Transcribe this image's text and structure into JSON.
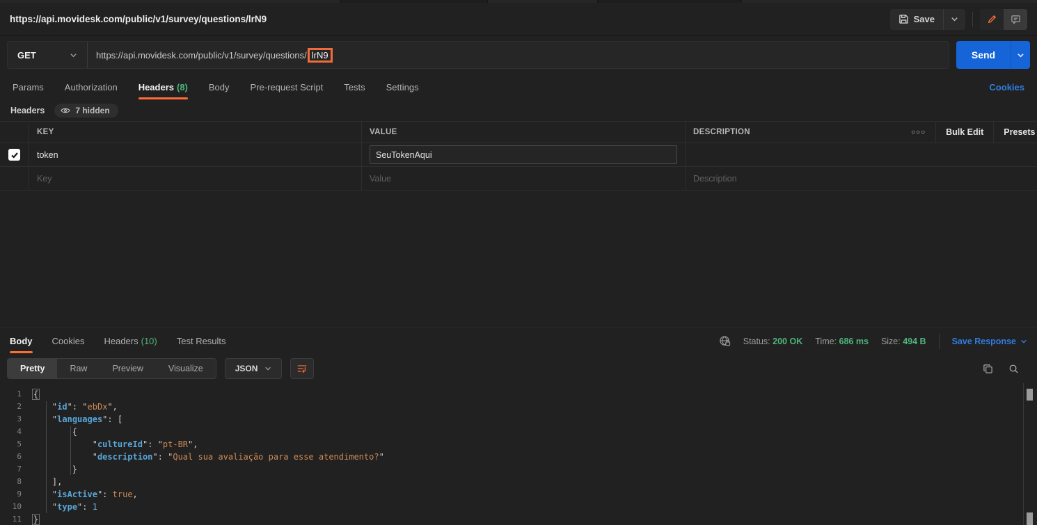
{
  "title_bar": {
    "title": "https://api.movidesk.com/public/v1/survey/questions/lrN9",
    "save_label": "Save"
  },
  "request": {
    "method": "GET",
    "url_prefix": "https://api.movidesk.com/public/v1/survey/questions/",
    "url_highlight": "lrN9",
    "send_label": "Send",
    "cookies_link": "Cookies",
    "tabs": [
      {
        "label": "Params"
      },
      {
        "label": "Authorization"
      },
      {
        "label": "Headers",
        "count": "(8)"
      },
      {
        "label": "Body"
      },
      {
        "label": "Pre-request Script"
      },
      {
        "label": "Tests"
      },
      {
        "label": "Settings"
      }
    ],
    "headers_section": {
      "title": "Headers",
      "hidden_badge": "7 hidden"
    },
    "table": {
      "columns": {
        "key": "KEY",
        "value": "VALUE",
        "description": "DESCRIPTION"
      },
      "bulk_edit": "Bulk Edit",
      "presets": "Presets",
      "row": {
        "key": "token",
        "value": "SeuTokenAqui",
        "description": ""
      },
      "placeholders": {
        "key": "Key",
        "value": "Value",
        "description": "Description"
      }
    }
  },
  "response": {
    "tabs": [
      {
        "label": "Body"
      },
      {
        "label": "Cookies"
      },
      {
        "label": "Headers",
        "count": "(10)"
      },
      {
        "label": "Test Results"
      }
    ],
    "meta": {
      "status_label": "Status:",
      "status_value": "200 OK",
      "time_label": "Time:",
      "time_value": "686 ms",
      "size_label": "Size:",
      "size_value": "494 B",
      "save_response": "Save Response"
    },
    "views": {
      "pretty": "Pretty",
      "raw": "Raw",
      "preview": "Preview",
      "visualize": "Visualize"
    },
    "format": "JSON",
    "code": {
      "lines": [
        {
          "n": "1",
          "t": [
            [
              "{",
              "pb"
            ]
          ]
        },
        {
          "n": "2",
          "t": [
            [
              "    ",
              ""
            ],
            [
              "\"",
              "q"
            ],
            [
              "id",
              "k"
            ],
            [
              "\"",
              "q"
            ],
            [
              ":",
              "p"
            ],
            [
              " ",
              ""
            ],
            [
              "\"",
              "q"
            ],
            [
              "ebDx",
              "s"
            ],
            [
              "\"",
              "q"
            ],
            [
              ",",
              "p"
            ]
          ]
        },
        {
          "n": "3",
          "t": [
            [
              "    ",
              ""
            ],
            [
              "\"",
              "q"
            ],
            [
              "languages",
              "k"
            ],
            [
              "\"",
              "q"
            ],
            [
              ":",
              "p"
            ],
            [
              " ",
              ""
            ],
            [
              "[",
              "p"
            ]
          ]
        },
        {
          "n": "4",
          "t": [
            [
              "        ",
              ""
            ],
            [
              "{",
              "p"
            ]
          ]
        },
        {
          "n": "5",
          "t": [
            [
              "            ",
              ""
            ],
            [
              "\"",
              "q"
            ],
            [
              "cultureId",
              "k"
            ],
            [
              "\"",
              "q"
            ],
            [
              ":",
              "p"
            ],
            [
              " ",
              ""
            ],
            [
              "\"",
              "q"
            ],
            [
              "pt-BR",
              "s"
            ],
            [
              "\"",
              "q"
            ],
            [
              ",",
              "p"
            ]
          ]
        },
        {
          "n": "6",
          "t": [
            [
              "            ",
              ""
            ],
            [
              "\"",
              "q"
            ],
            [
              "description",
              "k"
            ],
            [
              "\"",
              "q"
            ],
            [
              ":",
              "p"
            ],
            [
              " ",
              ""
            ],
            [
              "\"",
              "q"
            ],
            [
              "Qual sua avaliação para esse atendimento?",
              "s"
            ],
            [
              "\"",
              "q"
            ]
          ]
        },
        {
          "n": "7",
          "t": [
            [
              "        ",
              ""
            ],
            [
              "}",
              "p"
            ]
          ]
        },
        {
          "n": "8",
          "t": [
            [
              "    ",
              ""
            ],
            [
              "],",
              "p"
            ]
          ]
        },
        {
          "n": "9",
          "t": [
            [
              "    ",
              ""
            ],
            [
              "\"",
              "q"
            ],
            [
              "isActive",
              "k"
            ],
            [
              "\"",
              "q"
            ],
            [
              ":",
              "p"
            ],
            [
              " ",
              ""
            ],
            [
              "true",
              "b"
            ],
            [
              ",",
              "p"
            ]
          ]
        },
        {
          "n": "10",
          "t": [
            [
              "    ",
              ""
            ],
            [
              "\"",
              "q"
            ],
            [
              "type",
              "k"
            ],
            [
              "\"",
              "q"
            ],
            [
              ":",
              "p"
            ],
            [
              " ",
              ""
            ],
            [
              "1",
              "n"
            ]
          ]
        },
        {
          "n": "11",
          "t": [
            [
              "}",
              "pb"
            ]
          ]
        }
      ]
    }
  },
  "colors": {
    "accent_orange": "#ff6c37",
    "success_green": "#4db57c",
    "link_blue": "#2f7de1",
    "send_blue": "#1665d8"
  }
}
